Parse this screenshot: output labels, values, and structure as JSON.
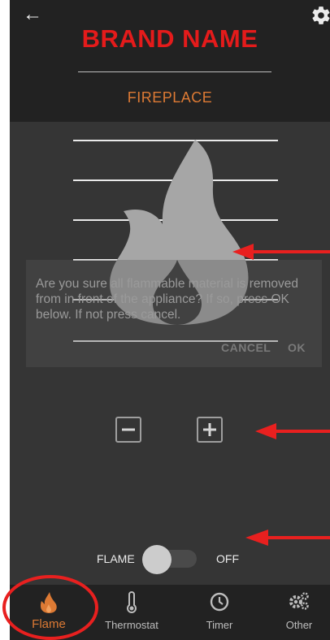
{
  "header": {
    "back_icon": "arrow-left-icon",
    "settings_icon": "gear-icon",
    "brand": "BRAND NAME",
    "subtitle": "FIREPLACE"
  },
  "dialog": {
    "message": "Are you sure all flammable material is removed from in front of the appliance? If so, press OK below. If not press cancel.",
    "cancel_label": "CANCEL",
    "ok_label": "OK"
  },
  "controls": {
    "minus_icon": "minus-icon",
    "plus_icon": "plus-icon",
    "toggle_label": "FLAME",
    "toggle_state": "OFF"
  },
  "nav": {
    "items": [
      {
        "label": "Flame",
        "icon": "flame-icon",
        "active": true
      },
      {
        "label": "Thermostat",
        "icon": "thermometer-icon",
        "active": false
      },
      {
        "label": "Timer",
        "icon": "clock-icon",
        "active": false
      },
      {
        "label": "Other",
        "icon": "gears-icon",
        "active": false
      }
    ]
  },
  "colors": {
    "brand": "#e41b1b",
    "accent": "#dd7a34",
    "background": "#353535",
    "header": "#222222",
    "annotation": "#e8201f"
  }
}
